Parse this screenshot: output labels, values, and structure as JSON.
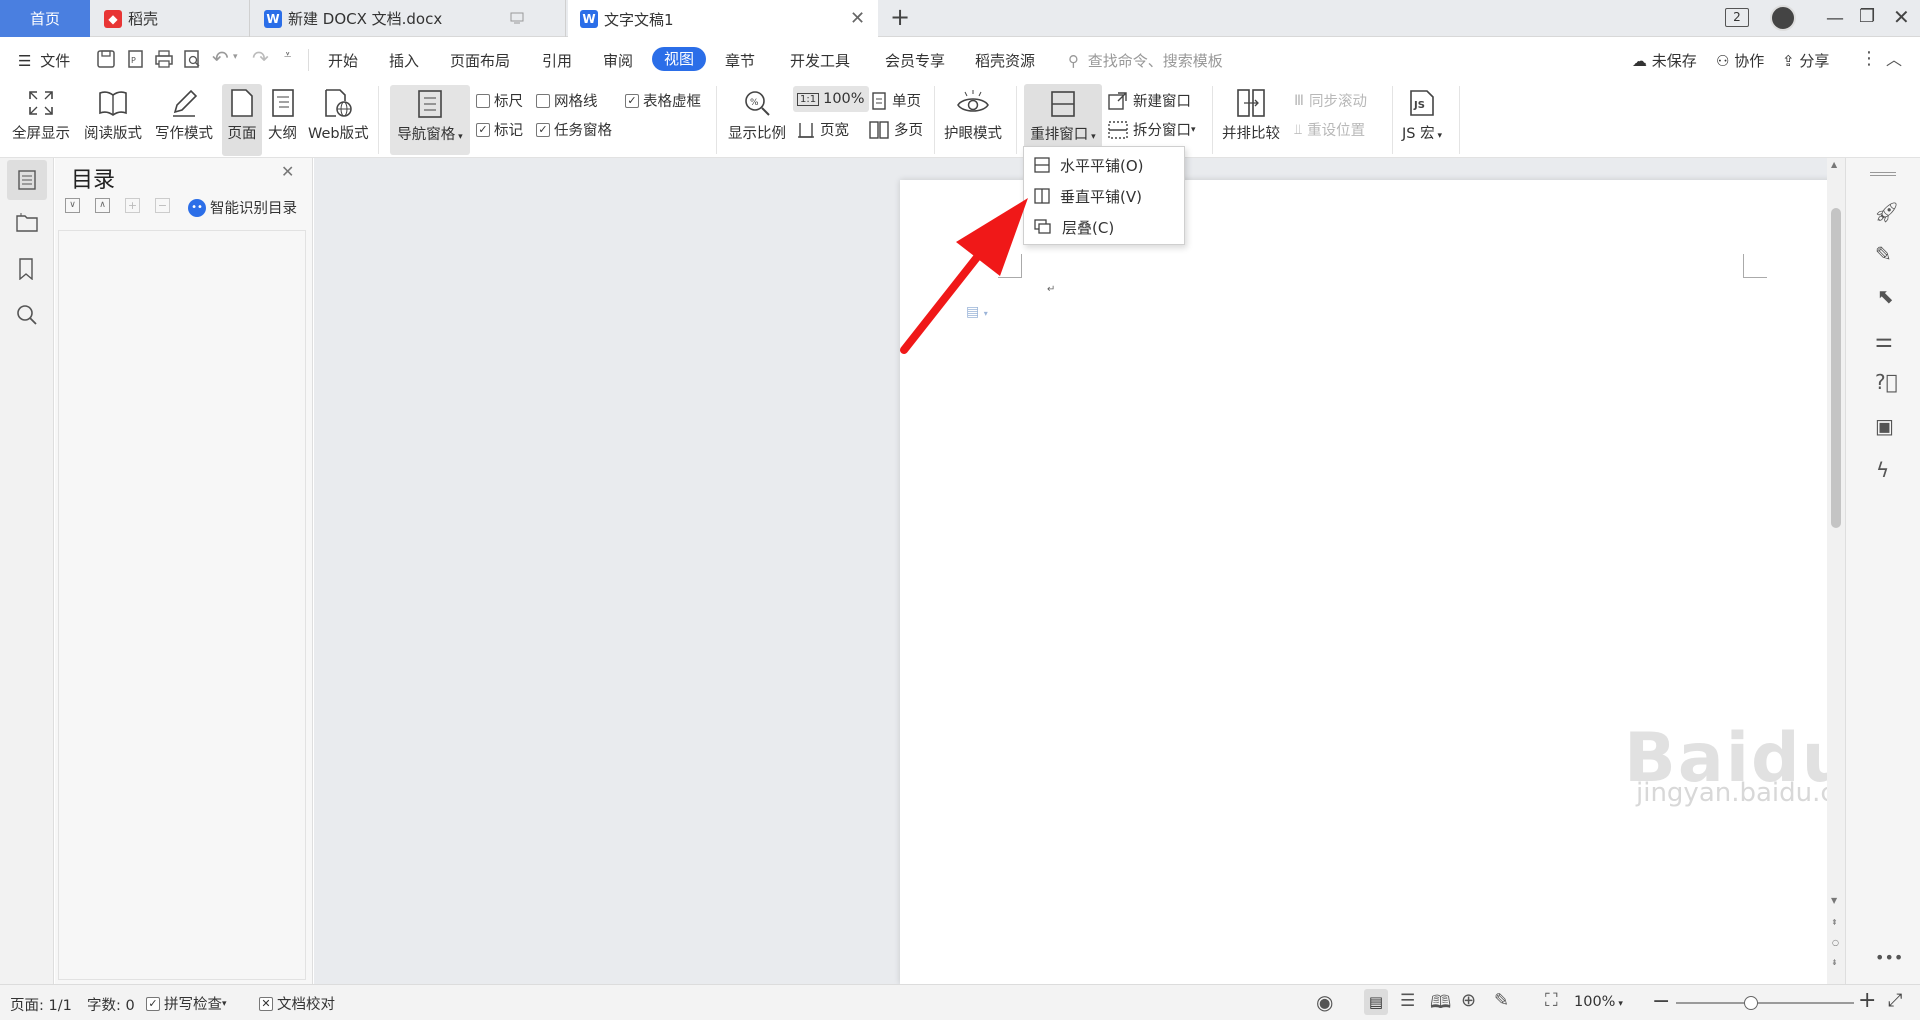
{
  "tabs": [
    {
      "label": "首页"
    },
    {
      "label": "稻壳"
    },
    {
      "label": "新建 DOCX 文档.docx"
    },
    {
      "label": "文字文稿1"
    }
  ],
  "titlebar": {
    "window_count": "2"
  },
  "menu": {
    "file": "文件",
    "items": [
      "开始",
      "插入",
      "页面布局",
      "引用",
      "审阅",
      "视图",
      "章节",
      "开发工具",
      "会员专享",
      "稻壳资源"
    ],
    "active": "视图",
    "search_placeholder": "查找命令、搜索模板",
    "unsaved": "未保存",
    "collab": "协作",
    "share": "分享"
  },
  "ribbon": {
    "fullscreen": "全屏显示",
    "reading": "阅读版式",
    "writing": "写作模式",
    "page": "页面",
    "outline": "大纲",
    "web": "Web版式",
    "nav_pane": "导航窗格",
    "ruler": "标尺",
    "gridlines": "网格线",
    "table_gridlines": "表格虚框",
    "markup": "标记",
    "task_pane": "任务窗格",
    "zoom": "显示比例",
    "zoom100": "100%",
    "page_width": "页宽",
    "single_page": "单页",
    "multi_page": "多页",
    "eye_mode": "护眼模式",
    "arrange": "重排窗口",
    "new_window": "新建窗口",
    "split_window": "拆分窗口",
    "side_by_side": "并排比较",
    "sync_scroll": "同步滚动",
    "reset_position": "重设位置",
    "js_macro": "JS 宏",
    "checked": {
      "ruler": false,
      "gridlines": false,
      "table_gridlines": true,
      "markup": true,
      "task_pane": true
    }
  },
  "dropdown": {
    "items": [
      "水平平铺(O)",
      "垂直平铺(V)",
      "层叠(C)"
    ]
  },
  "nav": {
    "title": "目录",
    "smart_toc": "智能识别目录"
  },
  "status": {
    "page": "页面: 1/1",
    "words": "字数: 0",
    "spell": "拼写检查",
    "proof": "文档校对",
    "zoom": "100%"
  },
  "watermark": {
    "brand": "Baidu经验",
    "url": "jingyan.baidu.com"
  },
  "colors": {
    "accent": "#2b6ee8",
    "arrow": "#f01818",
    "tab_home": "#4a7fe0"
  }
}
